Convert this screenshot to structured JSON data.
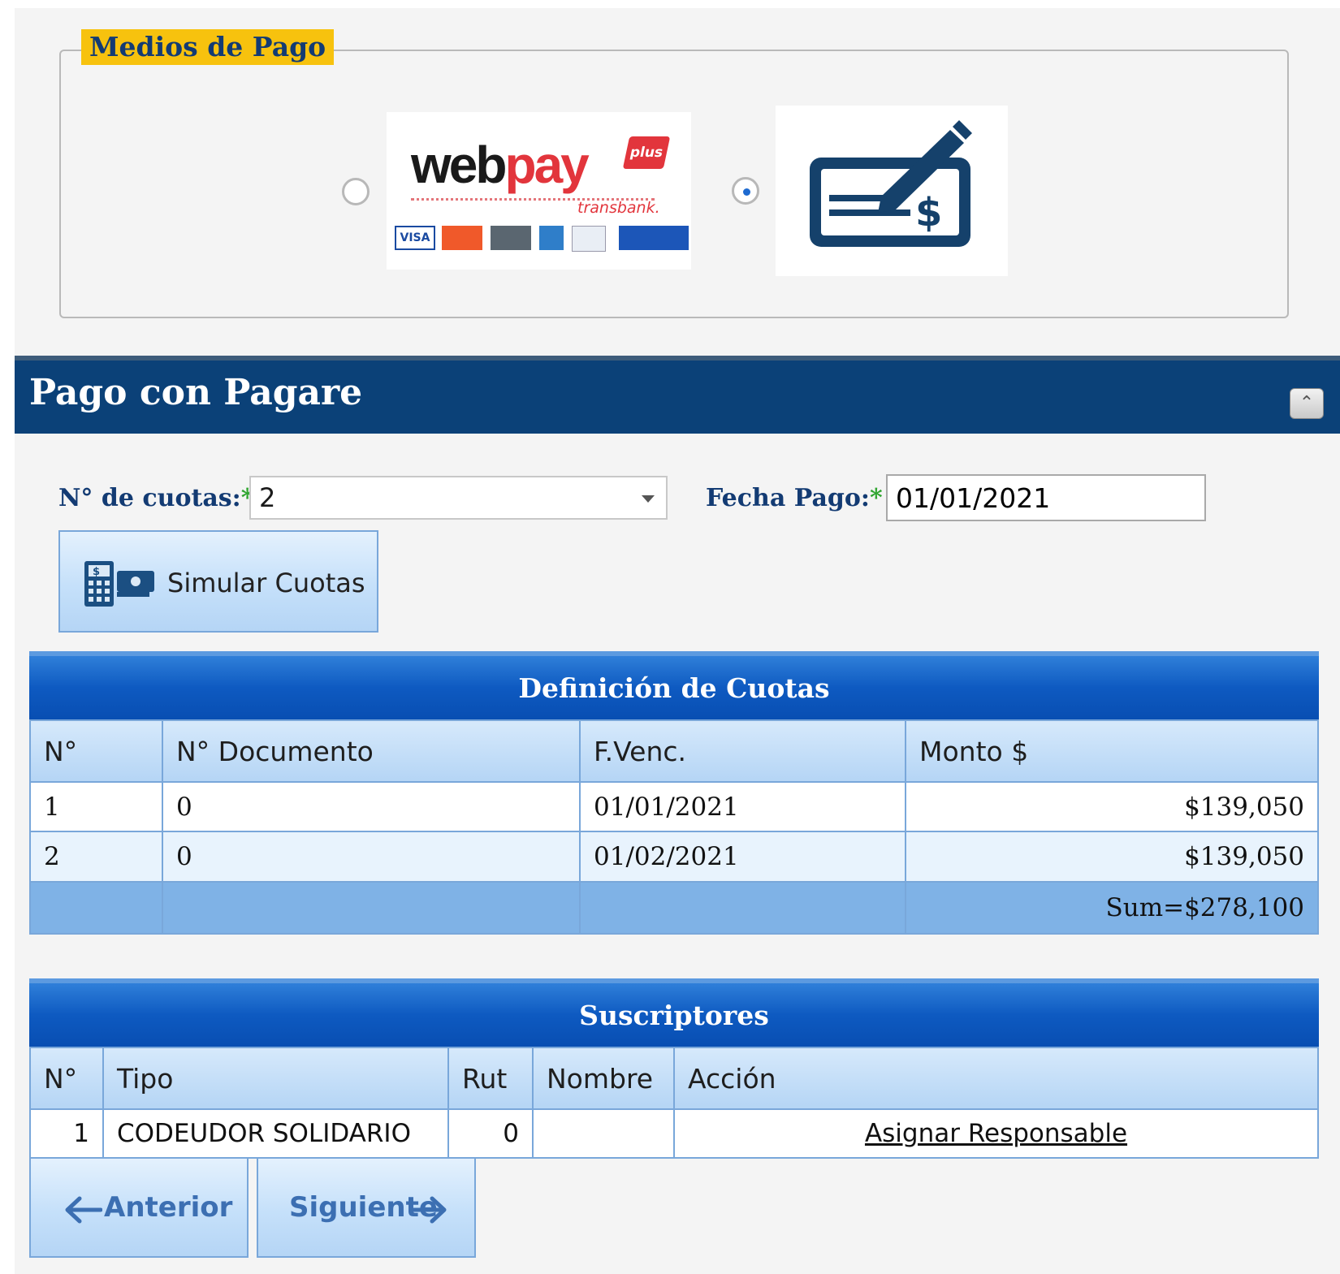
{
  "payment_methods": {
    "legend": "Medios de Pago",
    "webpay": {
      "brand_part1": "web",
      "brand_part2": "pay",
      "badge": "plus",
      "sub": "transbank.",
      "selected": false
    },
    "pagare": {
      "selected": true,
      "icon": "check-signature-icon"
    }
  },
  "section": {
    "title": "Pago con Pagare",
    "collapse_icon": "chevron-up-icon"
  },
  "form": {
    "cuotas_label": "N° de cuotas:",
    "cuotas_value": "2",
    "fecha_label": "Fecha Pago:",
    "fecha_value": "01/01/2021",
    "required_mark": "*",
    "simulate_button": "Simular Cuotas"
  },
  "cuotas_table": {
    "caption": "Definición de Cuotas",
    "headers": [
      "N°",
      "N° Documento",
      "F.Venc.",
      "Monto $"
    ],
    "rows": [
      [
        "1",
        "0",
        "01/01/2021",
        "$139,050"
      ],
      [
        "2",
        "0",
        "01/02/2021",
        "$139,050"
      ]
    ],
    "footer_sum": "Sum=$278,100"
  },
  "suscriptores_table": {
    "caption": "Suscriptores",
    "headers": [
      "N°",
      "Tipo",
      "Rut",
      "Nombre",
      "Acción"
    ],
    "rows": [
      {
        "n": "1",
        "tipo": "CODEUDOR SOLIDARIO",
        "rut": "0",
        "nombre": "",
        "accion": "Asignar Responsable"
      }
    ]
  },
  "nav": {
    "prev": "Anterior",
    "next": "Siguiente"
  },
  "colors": {
    "header": "#0b4178",
    "legend_bg": "#f7c20e",
    "accent": "#0e5ac1"
  }
}
